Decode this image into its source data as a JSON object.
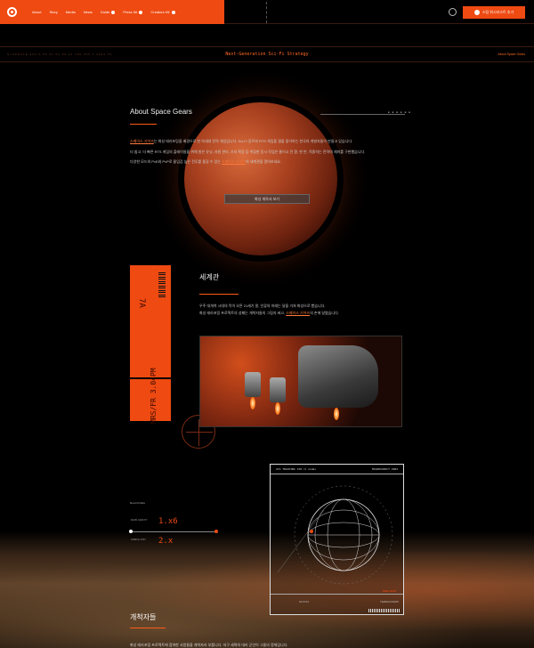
{
  "header": {
    "nav": [
      {
        "label": "About",
        "badge": false
      },
      {
        "label": "Story",
        "badge": false
      },
      {
        "label": "Media",
        "badge": false
      },
      {
        "label": "News",
        "badge": false
      },
      {
        "label": "Guide",
        "badge": true
      },
      {
        "label": "Press Kit",
        "badge": true
      },
      {
        "label": "Creators Kit",
        "badge": true
      }
    ],
    "cta_label": "스팀 위시리스트 추가",
    "accent": "#ee4a12"
  },
  "strip": {
    "left_text": "S=UPDATE   400   X:00   41.52   30:21   190   000   1.3264   70",
    "tagline": "Next-Generation Sci-Fi Strategy",
    "right_text": "About Space Gears"
  },
  "about": {
    "title": "About Space Gears",
    "deco_code": "■ ■ ■ ■ ■ ■",
    "p1_highlight": "스페이스 기어즈",
    "p1_rest": "는 화성 테라포밍을 배경으로 한 하세대 전략 게임입니다. Sci-Fi 장르와 RTS 게임을 결을 좋아하는 한국의 개발자들이 만들고 있습니다.",
    "p2": "더 쉽고, 더 빠른 RTS 게임의 플레이들을 위해 발은 유닛, 자원 관리, 기지 확장 등 복잡한 동시 작업은 줄이고 전 환, 한 번, 적중하는 전략의 재미를 구현했습니다.",
    "p3_pre": "다양한 모드의 PvE와 PvP로 몰입감 높은 전투를 즐길 수 있는 ",
    "p3_highlight": "스페이스 기어즈",
    "p3_post": "의 세계관을 알아보세요.",
    "button_label": "화성 게하서 보기"
  },
  "world": {
    "title": "세계관",
    "p1": "우주 대개척 시대의 막이 오른 21세기 말, 인류의 미래는 달을 거쳐 화성으로 뻗습니다.",
    "p2_pre": "화성 테라포밍 프로젝트의 성패는 개척자들의 그림자 싸고, ",
    "p2_highlight": "스페이스 기어즈",
    "p2_post": "의 손에 달렸습니다.",
    "ticket_code": "7A",
    "ticket_code2": "MRS/FR 3.04PM"
  },
  "crew": {
    "record_label": "Record Data",
    "stats": [
      {
        "label": "MARS\nGRAVITY",
        "value": "1.x6"
      },
      {
        "label": "ORBITAL\nDIST",
        "value": "2.x"
      }
    ],
    "hud_left": "ACS TRACKING   130 rx node>",
    "hud_right": "MOLNOSUPACT 4904",
    "hud_bottom_left": "02.6724",
    "hud_bottom_right": "TERRAFORMS",
    "hud_red": "MAR 18:00",
    "title": "개척자들",
    "p1": "화성 테라포밍 프로젝트에 참여한 사람들을 개척자라 부릅니다. 지구 세력의 대리 군인이 그들의 정체입니다."
  }
}
